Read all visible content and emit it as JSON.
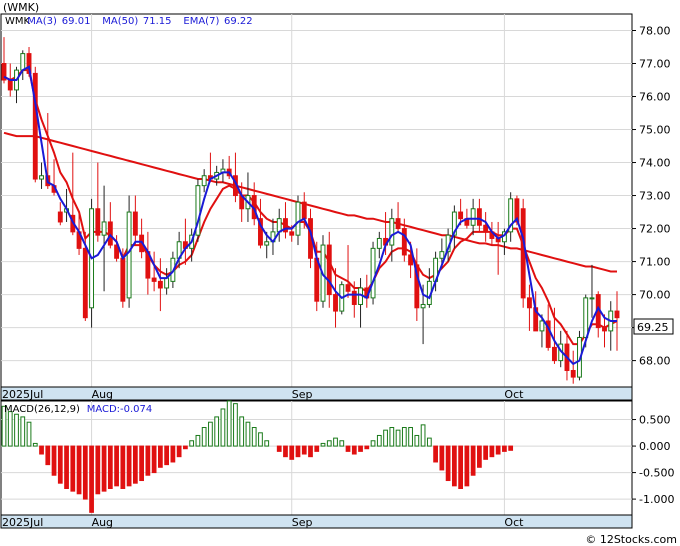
{
  "chart_data": [
    {
      "type": "candlestick",
      "ticker_label": "(WMK)",
      "legend": [
        {
          "text": "WMK",
          "color": "#000000"
        },
        {
          "text": "MA(3)",
          "color": "#1a1ad6"
        },
        {
          "text": "69.01",
          "color": "#1a1ad6"
        },
        {
          "text": "MA(50)",
          "color": "#1a1ad6"
        },
        {
          "text": "71.15",
          "color": "#1a1ad6"
        },
        {
          "text": "EMA(7)",
          "color": "#1a1ad6"
        },
        {
          "text": "69.22",
          "color": "#1a1ad6"
        }
      ],
      "last_price_label": "69.25",
      "yticks": [
        "68.00",
        "69.00",
        "70.00",
        "71.00",
        "72.00",
        "73.00",
        "74.00",
        "75.00",
        "76.00",
        "77.00",
        "78.00"
      ],
      "ylim": [
        67.2,
        78.5
      ],
      "xaxis_labels": [
        {
          "text": "2025Jul",
          "index": 0
        },
        {
          "text": "Aug",
          "index": 14
        },
        {
          "text": "Sep",
          "index": 46
        },
        {
          "text": "Oct",
          "index": 80
        }
      ],
      "colors": {
        "up": "#1a7a1a",
        "down": "#e01010",
        "ma_fast": "#1a1ad6",
        "ma_slow": "#e01010"
      },
      "candles": [
        [
          77.0,
          77.8,
          76.4,
          76.5
        ],
        [
          76.5,
          77.0,
          76.0,
          76.2
        ],
        [
          76.2,
          76.9,
          75.8,
          76.8
        ],
        [
          76.8,
          77.4,
          76.5,
          77.3
        ],
        [
          77.3,
          77.5,
          76.6,
          76.7
        ],
        [
          76.7,
          76.9,
          73.4,
          73.5
        ],
        [
          73.5,
          74.0,
          73.2,
          73.6
        ],
        [
          73.6,
          75.5,
          73.2,
          73.3
        ],
        [
          73.3,
          74.1,
          73.0,
          73.1
        ],
        [
          72.5,
          72.8,
          72.1,
          72.2
        ],
        [
          72.5,
          73.2,
          72.2,
          72.6
        ],
        [
          72.4,
          74.3,
          71.8,
          71.9
        ],
        [
          71.9,
          72.5,
          71.2,
          71.4
        ],
        [
          71.4,
          71.9,
          69.2,
          69.3
        ],
        [
          69.6,
          72.9,
          69.0,
          72.6
        ],
        [
          72.6,
          74.0,
          71.6,
          71.8
        ],
        [
          71.8,
          73.3,
          70.1,
          72.2
        ],
        [
          72.2,
          72.8,
          71.4,
          71.5
        ],
        [
          71.5,
          71.8,
          71.0,
          71.1
        ],
        [
          71.1,
          71.4,
          69.6,
          69.8
        ],
        [
          69.9,
          73.0,
          69.6,
          72.5
        ],
        [
          72.5,
          73.0,
          71.5,
          71.8
        ],
        [
          71.8,
          72.3,
          71.1,
          71.3
        ],
        [
          71.3,
          71.9,
          70.0,
          70.5
        ],
        [
          70.5,
          71.3,
          70.1,
          70.4
        ],
        [
          70.4,
          71.1,
          69.5,
          70.2
        ],
        [
          70.2,
          70.8,
          70.0,
          70.5
        ],
        [
          70.4,
          71.3,
          70.2,
          71.1
        ],
        [
          71.1,
          71.9,
          70.8,
          71.6
        ],
        [
          71.6,
          72.3,
          70.9,
          71.4
        ],
        [
          71.4,
          72.0,
          71.0,
          71.8
        ],
        [
          71.8,
          73.5,
          71.6,
          73.3
        ],
        [
          73.3,
          73.8,
          73.1,
          73.6
        ],
        [
          73.6,
          74.3,
          73.4,
          73.5
        ],
        [
          73.5,
          73.9,
          73.3,
          73.7
        ],
        [
          73.7,
          74.1,
          73.4,
          73.8
        ],
        [
          73.8,
          74.2,
          73.5,
          73.6
        ],
        [
          73.6,
          74.3,
          72.8,
          73.0
        ],
        [
          73.0,
          73.4,
          72.2,
          72.6
        ],
        [
          72.6,
          73.7,
          72.2,
          73.0
        ],
        [
          73.0,
          73.4,
          72.1,
          72.3
        ],
        [
          72.3,
          72.9,
          71.4,
          71.5
        ],
        [
          71.5,
          71.9,
          71.1,
          71.6
        ],
        [
          71.6,
          72.3,
          71.2,
          71.9
        ],
        [
          71.9,
          72.6,
          71.6,
          72.3
        ],
        [
          72.3,
          72.8,
          71.7,
          71.9
        ],
        [
          71.9,
          72.1,
          71.6,
          71.8
        ],
        [
          71.8,
          73.0,
          71.5,
          72.8
        ],
        [
          72.8,
          73.1,
          72.0,
          72.3
        ],
        [
          72.3,
          72.6,
          70.8,
          71.1
        ],
        [
          71.1,
          71.6,
          69.5,
          69.8
        ],
        [
          69.8,
          71.8,
          69.6,
          71.5
        ],
        [
          71.5,
          71.9,
          69.6,
          70.0
        ],
        [
          70.0,
          70.8,
          69.0,
          69.5
        ],
        [
          69.5,
          70.4,
          69.4,
          70.3
        ],
        [
          70.3,
          71.5,
          69.9,
          70.1
        ],
        [
          70.1,
          70.4,
          69.3,
          69.7
        ],
        [
          69.7,
          70.5,
          69.0,
          70.2
        ],
        [
          70.2,
          70.6,
          69.6,
          69.9
        ],
        [
          69.9,
          71.6,
          69.7,
          71.4
        ],
        [
          71.4,
          71.9,
          71.1,
          71.7
        ],
        [
          71.7,
          72.5,
          71.2,
          71.5
        ],
        [
          71.5,
          72.6,
          71.0,
          72.3
        ],
        [
          72.3,
          72.8,
          71.9,
          72.0
        ],
        [
          72.0,
          72.3,
          71.0,
          71.2
        ],
        [
          71.2,
          71.6,
          70.5,
          70.9
        ],
        [
          70.9,
          71.4,
          69.2,
          69.6
        ],
        [
          69.6,
          70.3,
          68.5,
          69.7
        ],
        [
          69.7,
          70.8,
          69.6,
          70.4
        ],
        [
          70.4,
          71.3,
          70.1,
          71.1
        ],
        [
          71.1,
          71.7,
          70.8,
          71.3
        ],
        [
          71.3,
          72.0,
          71.0,
          71.8
        ],
        [
          71.8,
          72.7,
          71.4,
          72.5
        ],
        [
          72.5,
          72.9,
          72.1,
          72.3
        ],
        [
          72.3,
          72.6,
          72.0,
          72.1
        ],
        [
          72.1,
          72.9,
          71.8,
          72.6
        ],
        [
          72.6,
          72.9,
          71.9,
          72.1
        ],
        [
          72.1,
          72.5,
          71.6,
          71.9
        ],
        [
          71.9,
          72.2,
          71.5,
          71.7
        ],
        [
          71.7,
          72.2,
          70.6,
          71.6
        ],
        [
          71.6,
          72.0,
          71.2,
          71.9
        ],
        [
          71.9,
          73.1,
          71.6,
          72.9
        ],
        [
          72.9,
          73.0,
          72.1,
          72.2
        ],
        [
          72.6,
          72.9,
          69.6,
          69.9
        ],
        [
          69.9,
          70.3,
          68.9,
          69.6
        ],
        [
          69.6,
          70.1,
          68.9,
          68.9
        ],
        [
          68.9,
          69.4,
          68.4,
          69.2
        ],
        [
          69.2,
          69.7,
          68.3,
          68.4
        ],
        [
          68.4,
          69.6,
          67.9,
          68.0
        ],
        [
          68.0,
          68.9,
          67.8,
          68.5
        ],
        [
          68.5,
          68.9,
          67.4,
          67.7
        ],
        [
          67.7,
          68.3,
          67.3,
          67.5
        ],
        [
          67.5,
          68.9,
          67.4,
          68.7
        ],
        [
          68.7,
          70.0,
          68.4,
          69.9
        ],
        [
          69.9,
          70.9,
          69.3,
          69.9
        ],
        [
          70.0,
          70.1,
          68.7,
          69.0
        ],
        [
          69.0,
          69.4,
          68.4,
          68.9
        ],
        [
          68.9,
          69.8,
          68.3,
          69.5
        ],
        [
          69.5,
          70.1,
          68.3,
          69.3
        ]
      ],
      "ma_fast": [
        76.6,
        76.5,
        76.5,
        76.8,
        76.9,
        75.8,
        74.6,
        73.4,
        73.3,
        72.9,
        72.6,
        72.2,
        71.9,
        71.5,
        71.1,
        71.2,
        71.5,
        71.8,
        71.6,
        71.1,
        71.3,
        71.6,
        71.6,
        71.3,
        70.9,
        70.5,
        70.5,
        70.7,
        71.1,
        71.4,
        71.6,
        72.2,
        72.9,
        73.5,
        73.6,
        73.7,
        73.7,
        73.4,
        73.0,
        72.8,
        72.6,
        72.1,
        71.8,
        71.6,
        71.9,
        72.0,
        72.0,
        72.2,
        72.3,
        71.9,
        71.1,
        70.6,
        70.4,
        70.1,
        69.9,
        70.0,
        70.0,
        70.0,
        69.9,
        70.4,
        70.9,
        71.5,
        71.8,
        71.9,
        71.8,
        71.5,
        70.6,
        70.0,
        69.9,
        70.4,
        70.9,
        71.4,
        71.9,
        72.2,
        72.3,
        72.3,
        72.3,
        72.2,
        71.9,
        71.7,
        71.8,
        72.1,
        72.3,
        71.7,
        70.6,
        69.5,
        69.3,
        69.0,
        68.6,
        68.3,
        68.1,
        67.9,
        68.0,
        68.6,
        69.2,
        69.6,
        69.3,
        69.2,
        69.2
      ],
      "ema": [
        76.6,
        76.5,
        76.6,
        76.8,
        76.8,
        75.9,
        75.3,
        74.8,
        74.3,
        73.7,
        73.4,
        72.9,
        72.5,
        71.7,
        71.9,
        71.9,
        71.9,
        71.8,
        71.6,
        71.1,
        71.5,
        71.5,
        71.5,
        71.2,
        70.9,
        70.7,
        70.6,
        70.7,
        70.9,
        71.0,
        71.2,
        71.7,
        72.2,
        72.6,
        72.9,
        73.2,
        73.3,
        73.2,
        73.0,
        73.0,
        72.8,
        72.5,
        72.3,
        72.2,
        72.2,
        72.1,
        72.0,
        72.2,
        72.2,
        71.9,
        71.3,
        71.3,
        71.0,
        70.6,
        70.5,
        70.4,
        70.2,
        70.2,
        70.1,
        70.4,
        70.8,
        71.0,
        71.3,
        71.4,
        71.4,
        71.3,
        70.9,
        70.6,
        70.5,
        70.6,
        70.8,
        71.0,
        71.4,
        71.6,
        71.7,
        71.9,
        71.9,
        71.9,
        71.9,
        71.8,
        71.8,
        72.0,
        72.0,
        71.5,
        71.0,
        70.5,
        70.2,
        69.8,
        69.3,
        69.1,
        68.8,
        68.5,
        68.5,
        68.8,
        69.1,
        69.1,
        69.0,
        69.1,
        69.2
      ],
      "ma_slow": [
        74.9,
        74.85,
        74.8,
        74.8,
        74.8,
        74.8,
        74.75,
        74.7,
        74.65,
        74.6,
        74.55,
        74.5,
        74.45,
        74.4,
        74.35,
        74.3,
        74.25,
        74.2,
        74.15,
        74.1,
        74.05,
        74.0,
        73.95,
        73.9,
        73.85,
        73.8,
        73.75,
        73.7,
        73.65,
        73.6,
        73.55,
        73.5,
        73.5,
        73.45,
        73.4,
        73.4,
        73.35,
        73.3,
        73.25,
        73.2,
        73.15,
        73.1,
        73.05,
        73.0,
        72.95,
        72.9,
        72.85,
        72.8,
        72.75,
        72.7,
        72.65,
        72.6,
        72.55,
        72.5,
        72.45,
        72.4,
        72.4,
        72.35,
        72.3,
        72.3,
        72.25,
        72.2,
        72.2,
        72.15,
        72.1,
        72.05,
        72.0,
        71.95,
        71.9,
        71.85,
        71.8,
        71.8,
        71.75,
        71.7,
        71.65,
        71.6,
        71.55,
        71.55,
        71.5,
        71.5,
        71.45,
        71.4,
        71.4,
        71.35,
        71.3,
        71.25,
        71.2,
        71.15,
        71.1,
        71.05,
        71.0,
        70.95,
        70.9,
        70.85,
        70.85,
        70.8,
        70.75,
        70.7,
        70.7
      ]
    },
    {
      "type": "bar",
      "legend": [
        {
          "text": "MACD(26,12,9)",
          "color": "#000000"
        },
        {
          "text": "MACD:-0.074",
          "color": "#1a1ad6"
        }
      ],
      "yticks": [
        "0.500",
        "0.000",
        "-0.500",
        "-1.000"
      ],
      "ylim": [
        -1.3,
        0.85
      ],
      "xaxis_labels": [
        {
          "text": "2025Jul",
          "index": 0
        },
        {
          "text": "Aug",
          "index": 14
        },
        {
          "text": "Sep",
          "index": 46
        },
        {
          "text": "Oct",
          "index": 80
        }
      ],
      "colors": {
        "positive": "#1a7a1a",
        "negative": "#e01010"
      },
      "values": [
        0.75,
        0.65,
        0.6,
        0.55,
        0.45,
        0.05,
        -0.15,
        -0.35,
        -0.55,
        -0.7,
        -0.8,
        -0.85,
        -0.9,
        -1.0,
        -1.25,
        -0.9,
        -0.85,
        -0.8,
        -0.75,
        -0.8,
        -0.75,
        -0.7,
        -0.65,
        -0.55,
        -0.5,
        -0.4,
        -0.35,
        -0.3,
        -0.2,
        -0.05,
        0.1,
        0.2,
        0.35,
        0.45,
        0.55,
        0.7,
        0.85,
        0.8,
        0.55,
        0.45,
        0.35,
        0.25,
        0.1,
        0.0,
        -0.1,
        -0.2,
        -0.25,
        -0.2,
        -0.15,
        -0.2,
        -0.1,
        0.05,
        0.1,
        0.15,
        0.1,
        -0.1,
        -0.15,
        -0.1,
        -0.05,
        0.1,
        0.2,
        0.3,
        0.35,
        0.3,
        0.35,
        0.35,
        0.2,
        0.4,
        0.15,
        -0.3,
        -0.45,
        -0.65,
        -0.75,
        -0.8,
        -0.75,
        -0.55,
        -0.4,
        -0.25,
        -0.2,
        -0.15,
        -0.1,
        -0.08
      ]
    }
  ],
  "watermark": "© 12Stocks.com"
}
